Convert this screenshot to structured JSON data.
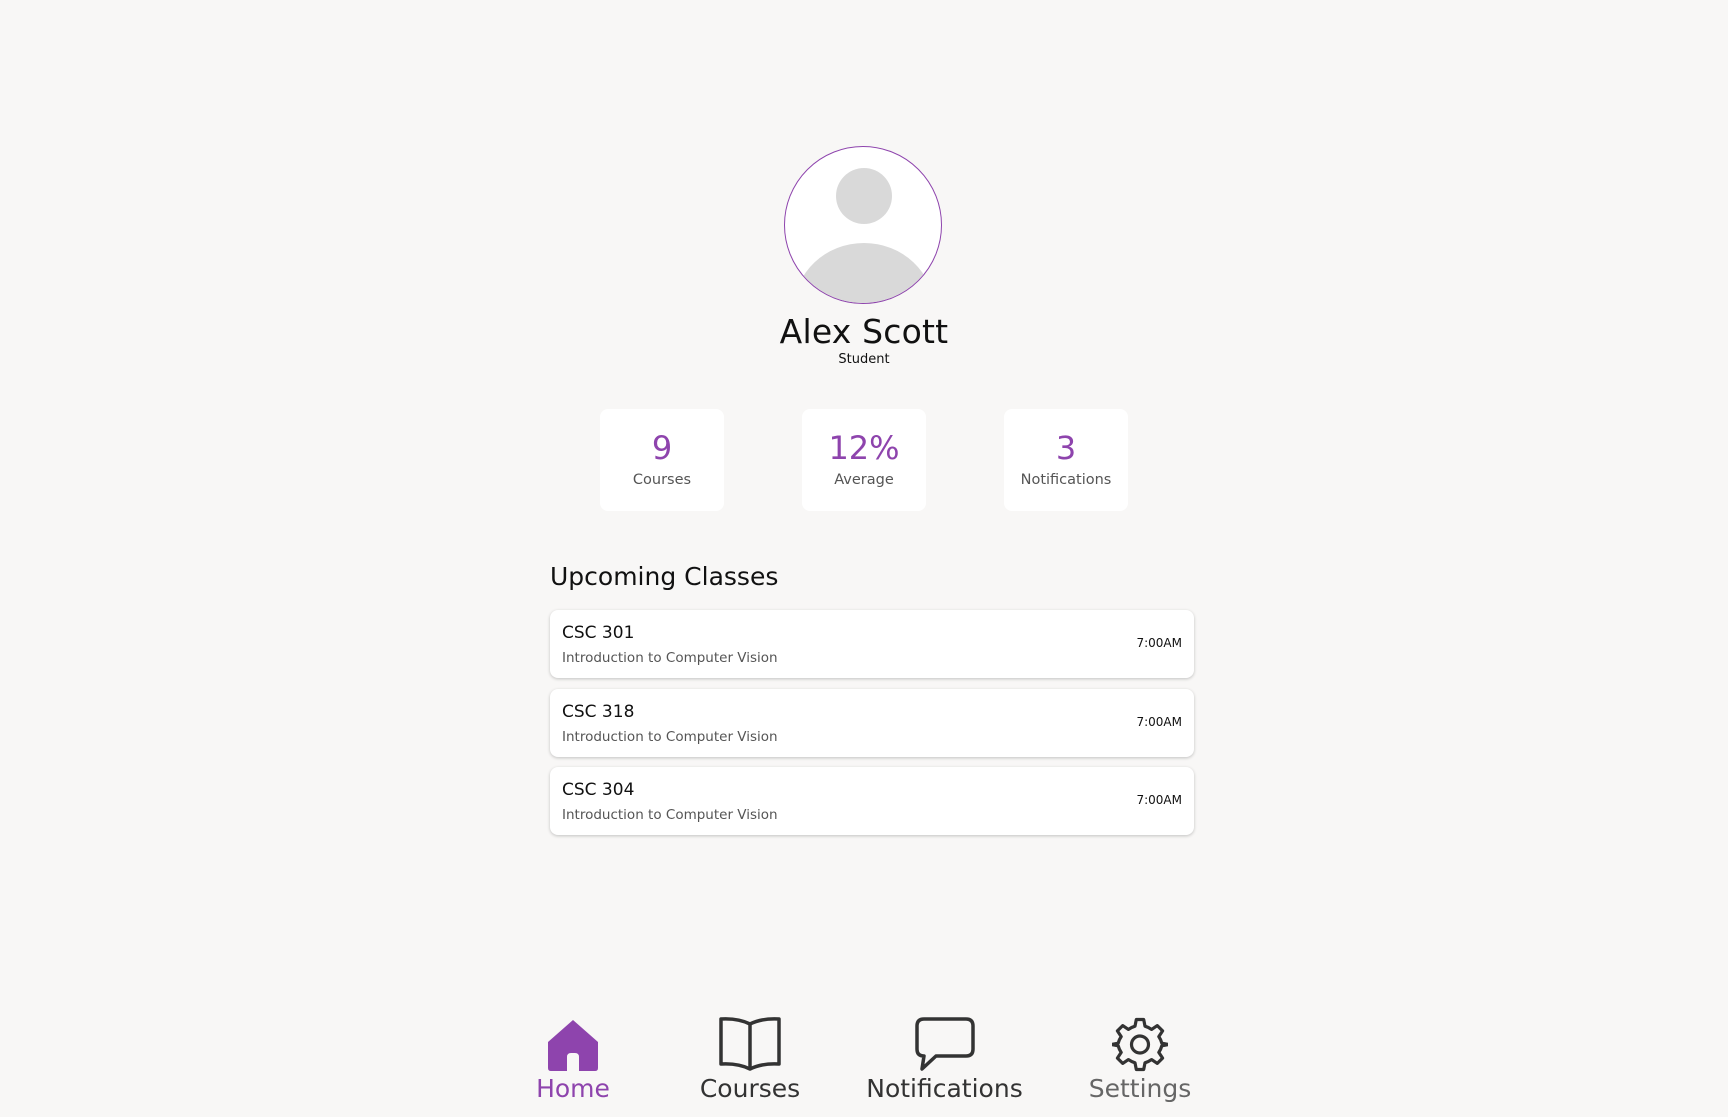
{
  "profile": {
    "name": "Alex Scott",
    "role": "Student"
  },
  "stats": [
    {
      "value": "9",
      "label": "Courses"
    },
    {
      "value": "12%",
      "label": "Average"
    },
    {
      "value": "3",
      "label": "Notifications"
    }
  ],
  "upcoming": {
    "title": "Upcoming Classes",
    "classes": [
      {
        "code": "CSC 301",
        "description": "Introduction to Computer Vision",
        "time": "7:00AM"
      },
      {
        "code": "CSC 318",
        "description": "Introduction to Computer Vision",
        "time": "7:00AM"
      },
      {
        "code": "CSC 304",
        "description": "Introduction to Computer Vision",
        "time": "7:00AM"
      }
    ]
  },
  "nav": {
    "items": [
      {
        "label": "Home",
        "icon": "home-icon",
        "active": true
      },
      {
        "label": "Courses",
        "icon": "book-icon",
        "active": false
      },
      {
        "label": "Notifications",
        "icon": "chat-bubble-icon",
        "active": false
      },
      {
        "label": "Settings",
        "icon": "gear-icon",
        "active": false
      }
    ]
  },
  "colors": {
    "accent": "#8e44ad",
    "background": "#f8f7f6",
    "icon_inactive": "#333333",
    "label_inactive": "#666666"
  }
}
